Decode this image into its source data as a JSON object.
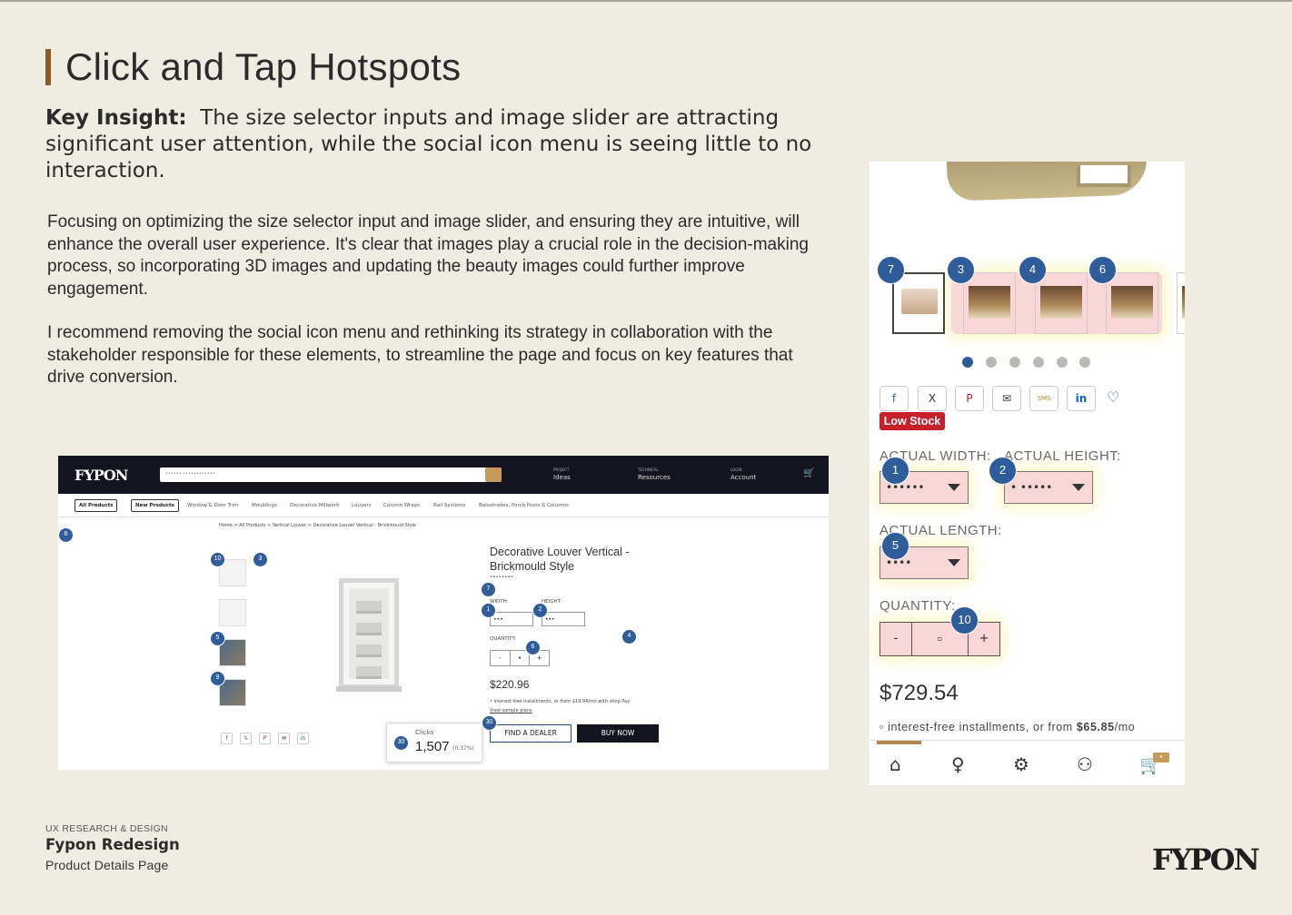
{
  "slide": {
    "title": "Click and Tap Hotspots",
    "insight_label": "Key Insight:",
    "insight_text": "The size selector inputs and image slider are attracting significant user attention, while the social icon menu is seeing little to no interaction.",
    "paragraph_1": "Focusing on optimizing the size selector input and image slider, and ensuring they are intuitive, will enhance the overall user experience. It's clear that images play a crucial role in the decision-making process, so incorporating 3D images and updating the beauty images could further improve engagement.",
    "paragraph_2": "I recommend removing the social icon menu and rethinking its strategy in collaboration with the stakeholder responsible for these elements, to streamline the page and focus on key features that drive conversion.",
    "accent_color": "#8b5a2b",
    "background_color": "#f0ece2"
  },
  "desktop": {
    "logo": "FYPON",
    "search_placeholder": "•••••• ••••••••••••",
    "nav": [
      {
        "small": "PROJECT",
        "label": "Ideas",
        "icon": "lightbulb-icon"
      },
      {
        "small": "TECHNICAL",
        "label": "Resources",
        "icon": "gear-icon"
      },
      {
        "small": "LOGIN",
        "label": "Account",
        "icon": "user-icon"
      }
    ],
    "subnav_pills": [
      "All Products",
      "New Products"
    ],
    "subnav_links": [
      "Window & Door Trim",
      "Mouldings",
      "Decorative Millwork",
      "Louvers",
      "Column Wraps",
      "Rail Systems",
      "Balustrades, Porch Posts & Columns"
    ],
    "breadcrumb": "Home > All Products > Vertical Louver > Decorative Louver Vertical - Brickmould Style",
    "product_title": "Decorative Louver Vertical - Brickmould Style",
    "product_sku": "••••••••",
    "width_label": "WIDTH:",
    "height_label": "HEIGHT:",
    "width_value": "•••",
    "height_value": "•••",
    "quantity_label": "QUANTITY:",
    "qty_minus": "-",
    "qty_value": "•",
    "qty_plus": "+",
    "price": "$220.96",
    "installments": "• interest-free installments, or from $19.94/mo with shop Pay",
    "sample_link": "View sample plans",
    "dealer_button": "FIND A DEALER",
    "buy_button": "BUY NOW",
    "tooltip": {
      "label": "Clicks",
      "value": "1,507",
      "percent": "(0.37%)",
      "rank": "30"
    },
    "hotspots": [
      "8",
      "10",
      "3",
      "5",
      "9",
      "7",
      "1",
      "2",
      "6",
      "4",
      "30"
    ]
  },
  "mobile": {
    "hotspots": [
      "7",
      "3",
      "4",
      "6",
      "1",
      "2",
      "5",
      "10"
    ],
    "social": [
      "f",
      "X",
      "P",
      "✉",
      "SMS",
      "in"
    ],
    "low_stock": "Low Stock",
    "width_label": "ACTUAL WIDTH:",
    "height_label": "ACTUAL HEIGHT:",
    "length_label": "ACTUAL LENGTH:",
    "width_value": "••••••",
    "height_value": "• •••••",
    "length_value": "••••",
    "quantity_label": "QUANTITY:",
    "qty_minus": "-",
    "qty_value": "▫",
    "qty_plus": "+",
    "price": "$729.54",
    "installments_prefix": "▫ interest-free installments, or from ",
    "installments_amount": "$65.85",
    "installments_suffix": "/mo",
    "cart_badge": "•",
    "tabs": [
      "home-icon",
      "lightbulb-icon",
      "gear-icon",
      "user-icon",
      "cart-icon"
    ]
  },
  "footer": {
    "category": "UX RESEARCH & DESIGN",
    "project": "Fypon Redesign",
    "page": "Product Details Page",
    "brand": "FYPON"
  }
}
